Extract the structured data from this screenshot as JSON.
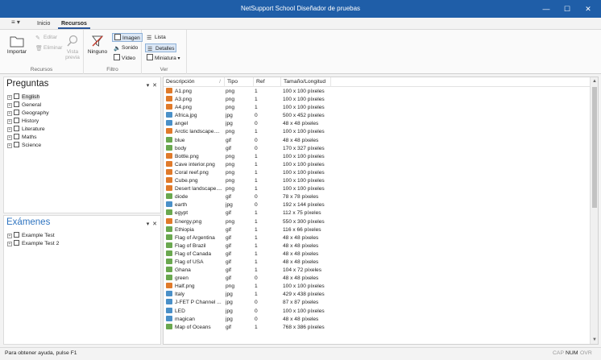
{
  "window": {
    "title": "NetSupport School Diseñador de pruebas",
    "minimize": "—",
    "maximize": "☐",
    "close": "✕"
  },
  "tabs": [
    {
      "label": "Inicio"
    },
    {
      "label": "Recursos"
    }
  ],
  "ribbon": {
    "recursos": {
      "label": "Recursos",
      "importar": "Importar",
      "editar": "Editar",
      "eliminar": "Eliminar",
      "vista_previa": "Vista previa"
    },
    "filtro": {
      "label": "Filtro",
      "ninguno": "Ninguno",
      "imagen": "Imagen",
      "sonido": "Sonido",
      "video": "Vídeo"
    },
    "ver": {
      "label": "Ver",
      "lista": "Lista",
      "detalles": "Detalles",
      "miniatura": "Miniatura"
    }
  },
  "preguntas": {
    "title": "Preguntas",
    "items": [
      "English",
      "General",
      "Geography",
      "History",
      "Literature",
      "Maths",
      "Science"
    ]
  },
  "examenes": {
    "title": "Exámenes",
    "items": [
      "Example Test",
      "Example Test 2"
    ]
  },
  "list": {
    "columns": [
      "Descripción",
      "Tipo",
      "Ref",
      "Tamaño/Longitud"
    ],
    "rows": [
      {
        "desc": "A1.png",
        "tipo": "png",
        "ref": "1",
        "size": "100 x 100 píxeles",
        "icon": "png"
      },
      {
        "desc": "A3.png",
        "tipo": "png",
        "ref": "1",
        "size": "100 x 100 píxeles",
        "icon": "png"
      },
      {
        "desc": "A4.png",
        "tipo": "png",
        "ref": "1",
        "size": "100 x 100 píxeles",
        "icon": "png"
      },
      {
        "desc": "Africa.jpg",
        "tipo": "jpg",
        "ref": "0",
        "size": "500 x 452 píxeles",
        "icon": "jpg"
      },
      {
        "desc": "angel",
        "tipo": "jpg",
        "ref": "0",
        "size": "48 x 48 píxeles",
        "icon": "jpg"
      },
      {
        "desc": "Arctic landscape....",
        "tipo": "png",
        "ref": "1",
        "size": "100 x 100 píxeles",
        "icon": "png"
      },
      {
        "desc": "blue",
        "tipo": "gif",
        "ref": "0",
        "size": "48 x 48 píxeles",
        "icon": "gif"
      },
      {
        "desc": "body",
        "tipo": "gif",
        "ref": "0",
        "size": "170 x 327 píxeles",
        "icon": "gif"
      },
      {
        "desc": "Bottle.png",
        "tipo": "png",
        "ref": "1",
        "size": "100 x 100 píxeles",
        "icon": "png"
      },
      {
        "desc": "Cave interior.png",
        "tipo": "png",
        "ref": "1",
        "size": "100 x 100 píxeles",
        "icon": "png"
      },
      {
        "desc": "Coral reef.png",
        "tipo": "png",
        "ref": "1",
        "size": "100 x 100 píxeles",
        "icon": "png"
      },
      {
        "desc": "Cube.png",
        "tipo": "png",
        "ref": "1",
        "size": "100 x 100 píxeles",
        "icon": "png"
      },
      {
        "desc": "Desert landscape....",
        "tipo": "png",
        "ref": "1",
        "size": "100 x 100 píxeles",
        "icon": "png"
      },
      {
        "desc": "diode",
        "tipo": "gif",
        "ref": "0",
        "size": "78 x 78 píxeles",
        "icon": "gif"
      },
      {
        "desc": "earth",
        "tipo": "jpg",
        "ref": "0",
        "size": "192 x 144 píxeles",
        "icon": "jpg"
      },
      {
        "desc": "egypt",
        "tipo": "gif",
        "ref": "1",
        "size": "112 x 75 píxeles",
        "icon": "gif"
      },
      {
        "desc": "Energy.png",
        "tipo": "png",
        "ref": "1",
        "size": "550 x 300 píxeles",
        "icon": "png"
      },
      {
        "desc": "Ethiopia",
        "tipo": "gif",
        "ref": "1",
        "size": "116 x 66 píxeles",
        "icon": "gif"
      },
      {
        "desc": "Flag of Argentina",
        "tipo": "gif",
        "ref": "1",
        "size": "48 x 48 píxeles",
        "icon": "gif"
      },
      {
        "desc": "Flag of Brazil",
        "tipo": "gif",
        "ref": "1",
        "size": "48 x 48 píxeles",
        "icon": "gif"
      },
      {
        "desc": "Flag of Canada",
        "tipo": "gif",
        "ref": "1",
        "size": "48 x 48 píxeles",
        "icon": "gif"
      },
      {
        "desc": "Flag of USA",
        "tipo": "gif",
        "ref": "1",
        "size": "48 x 48 píxeles",
        "icon": "gif"
      },
      {
        "desc": "Ghana",
        "tipo": "gif",
        "ref": "1",
        "size": "104 x 72 píxeles",
        "icon": "gif"
      },
      {
        "desc": "green",
        "tipo": "gif",
        "ref": "0",
        "size": "48 x 48 píxeles",
        "icon": "gif"
      },
      {
        "desc": "Half.png",
        "tipo": "png",
        "ref": "1",
        "size": "100 x 100 píxeles",
        "icon": "png"
      },
      {
        "desc": "Italy",
        "tipo": "jpg",
        "ref": "1",
        "size": "429 x 438 píxeles",
        "icon": "jpg"
      },
      {
        "desc": "J-FET P Channel ...",
        "tipo": "jpg",
        "ref": "0",
        "size": "87 x 87 píxeles",
        "icon": "jpg"
      },
      {
        "desc": "LED",
        "tipo": "jpg",
        "ref": "0",
        "size": "100 x 100 píxeles",
        "icon": "jpg"
      },
      {
        "desc": "magican",
        "tipo": "jpg",
        "ref": "0",
        "size": "48 x 48 píxeles",
        "icon": "jpg"
      },
      {
        "desc": "Map of Oceans",
        "tipo": "gif",
        "ref": "1",
        "size": "768 x 386 píxeles",
        "icon": "gif"
      }
    ]
  },
  "status": {
    "message": "Para obtener ayuda, pulse F1",
    "cap": "CAP",
    "num": "NUM",
    "ovr": "OVR"
  },
  "colors": {
    "titlebar": "#1f5ea8",
    "accent": "#2b579a",
    "png_icon": "#e07a2a",
    "jpg_icon": "#4a90c8",
    "gif_icon": "#6aa84f"
  }
}
